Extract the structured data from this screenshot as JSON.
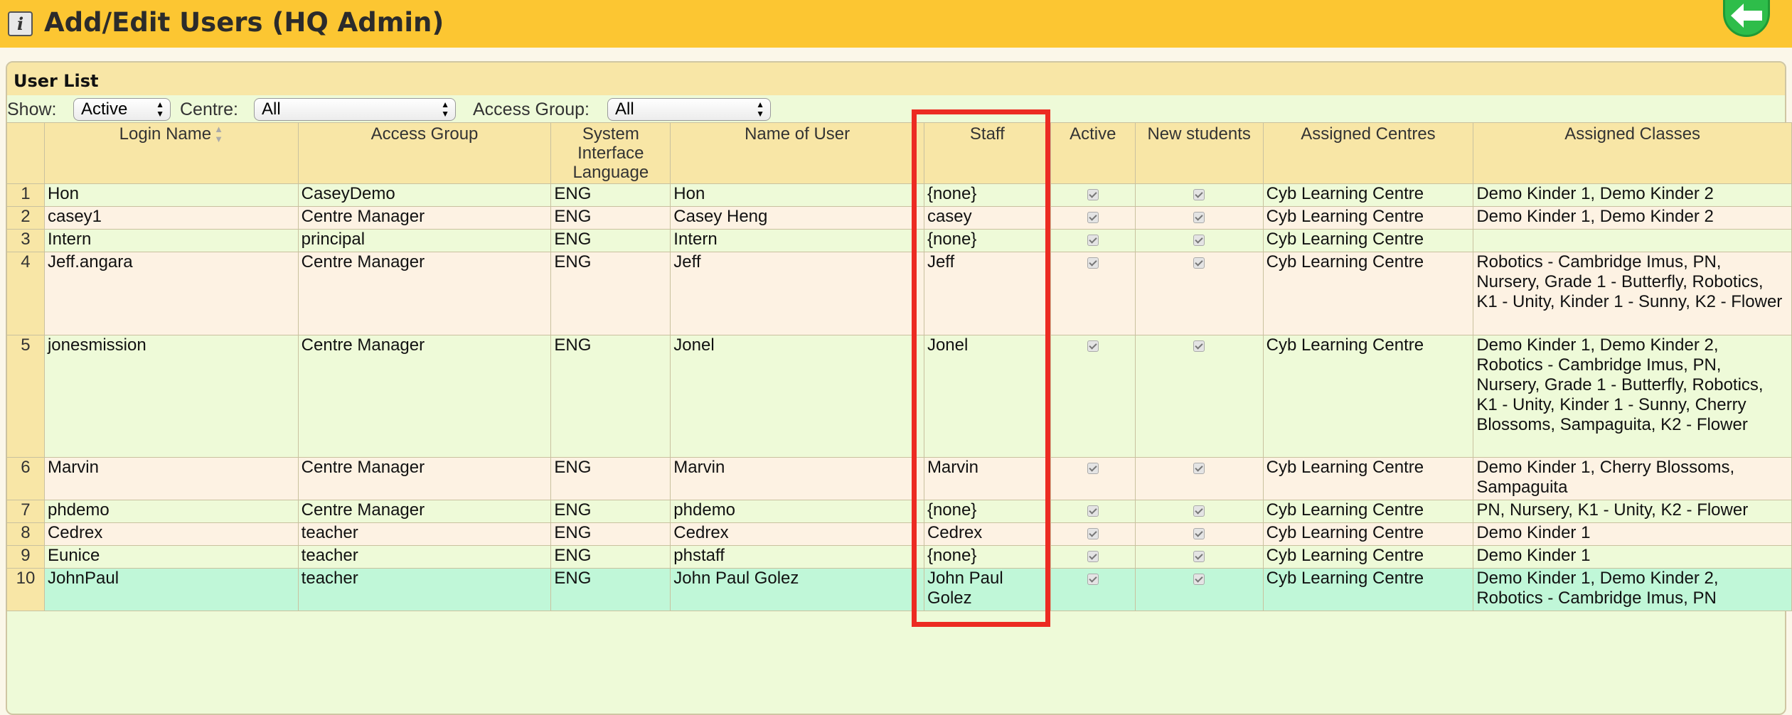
{
  "header": {
    "title": "Add/Edit Users (HQ Admin)"
  },
  "panel": {
    "title": "User List"
  },
  "filters": {
    "show_label": "Show:",
    "show_value": "Active",
    "centre_label": "Centre:",
    "centre_value": "All",
    "access_label": "Access Group:",
    "access_value": "All"
  },
  "columns": [
    "",
    "Login Name",
    "Access Group",
    "System Interface Language",
    "Name of User",
    "Staff",
    "Active",
    "New students",
    "Assigned Centres",
    "Assigned Classes"
  ],
  "rows": [
    {
      "n": "1",
      "login": "Hon",
      "group": "CaseyDemo",
      "lang": "ENG",
      "name": "Hon",
      "staff": "{none}",
      "centres": "Cyb Learning Centre",
      "classes": "Demo Kinder 1, Demo Kinder 2"
    },
    {
      "n": "2",
      "login": "casey1",
      "group": "Centre Manager",
      "lang": "ENG",
      "name": "Casey Heng",
      "staff": "casey",
      "centres": "Cyb Learning Centre",
      "classes": "Demo Kinder 1, Demo Kinder 2"
    },
    {
      "n": "3",
      "login": "Intern",
      "group": "principal",
      "lang": "ENG",
      "name": "Intern",
      "staff": "{none}",
      "centres": "Cyb Learning Centre",
      "classes": ""
    },
    {
      "n": "4",
      "login": "Jeff.angara",
      "group": "Centre Manager",
      "lang": "ENG",
      "name": "Jeff",
      "staff": "Jeff",
      "centres": "Cyb Learning Centre",
      "classes": "Robotics - Cambridge Imus, PN, Nursery, Grade 1 - Butterfly, Robotics, K1 - Unity, Kinder 1 - Sunny, K2 - Flower"
    },
    {
      "n": "5",
      "login": "jonesmission",
      "group": "Centre Manager",
      "lang": "ENG",
      "name": "Jonel",
      "staff": "Jonel",
      "centres": "Cyb Learning Centre",
      "classes": "Demo Kinder 1, Demo Kinder 2, Robotics - Cambridge Imus, PN, Nursery, Grade 1 - Butterfly, Robotics, K1 - Unity, Kinder 1 - Sunny, Cherry Blossoms, Sampaguita, K2 - Flower"
    },
    {
      "n": "6",
      "login": "Marvin",
      "group": "Centre Manager",
      "lang": "ENG",
      "name": "Marvin",
      "staff": "Marvin",
      "centres": "Cyb Learning Centre",
      "classes": "Demo Kinder 1, Cherry Blossoms, Sampaguita"
    },
    {
      "n": "7",
      "login": "phdemo",
      "group": "Centre Manager",
      "lang": "ENG",
      "name": "phdemo",
      "staff": "{none}",
      "centres": "Cyb Learning Centre",
      "classes": "PN, Nursery, K1 - Unity, K2 - Flower"
    },
    {
      "n": "8",
      "login": "Cedrex",
      "group": "teacher",
      "lang": "ENG",
      "name": "Cedrex",
      "staff": "Cedrex",
      "centres": "Cyb Learning Centre",
      "classes": "Demo Kinder 1"
    },
    {
      "n": "9",
      "login": "Eunice",
      "group": "teacher",
      "lang": "ENG",
      "name": "phstaff",
      "staff": "{none}",
      "centres": "Cyb Learning Centre",
      "classes": "Demo Kinder 1"
    },
    {
      "n": "10",
      "login": "JohnPaul",
      "group": "teacher",
      "lang": "ENG",
      "name": "John Paul Golez",
      "staff": "John Paul Golez",
      "centres": "Cyb Learning Centre",
      "classes": "Demo Kinder 1, Demo Kinder 2, Robotics - Cambridge Imus, PN"
    }
  ],
  "colors": {
    "header_bar": "#fcc632",
    "highlight": "#ec2b22",
    "row_green": "#eefad8",
    "row_peach": "#fdf2e3"
  }
}
